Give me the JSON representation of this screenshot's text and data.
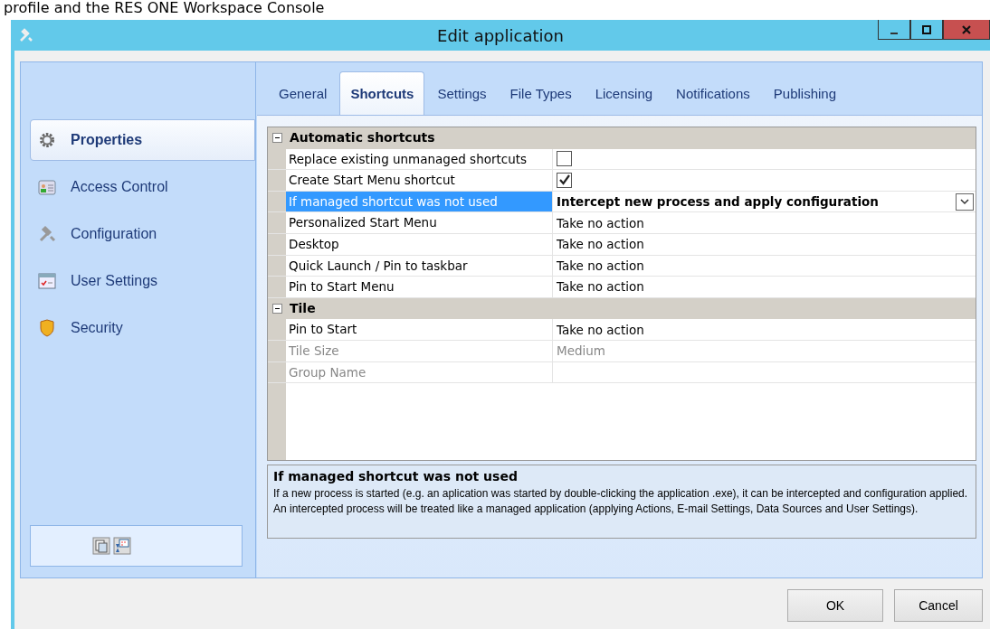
{
  "caption_fragment": "profile and the RES ONE Workspace Console",
  "window": {
    "title": "Edit application"
  },
  "sidebar": {
    "items": [
      {
        "label": "Properties",
        "selected": true
      },
      {
        "label": "Access Control",
        "selected": false
      },
      {
        "label": "Configuration",
        "selected": false
      },
      {
        "label": "User Settings",
        "selected": false
      },
      {
        "label": "Security",
        "selected": false
      }
    ]
  },
  "tabs": [
    {
      "label": "General",
      "selected": false
    },
    {
      "label": "Shortcuts",
      "selected": true
    },
    {
      "label": "Settings",
      "selected": false
    },
    {
      "label": "File Types",
      "selected": false
    },
    {
      "label": "Licensing",
      "selected": false
    },
    {
      "label": "Notifications",
      "selected": false
    },
    {
      "label": "Publishing",
      "selected": false
    }
  ],
  "grid": {
    "groups": [
      {
        "title": "Automatic shortcuts",
        "expanded": true,
        "rows": [
          {
            "label": "Replace existing unmanaged shortcuts",
            "kind": "check",
            "checked": false,
            "selected": false,
            "disabled": false
          },
          {
            "label": "Create Start Menu shortcut",
            "kind": "check",
            "checked": true,
            "selected": false,
            "disabled": false
          },
          {
            "label": "If managed shortcut was not used",
            "kind": "dropdown",
            "value": "Intercept new process and apply configuration",
            "selected": true,
            "disabled": false
          },
          {
            "label": "Personalized Start Menu",
            "kind": "text",
            "value": "Take no action",
            "selected": false,
            "disabled": false
          },
          {
            "label": "Desktop",
            "kind": "text",
            "value": "Take no action",
            "selected": false,
            "disabled": false
          },
          {
            "label": "Quick Launch / Pin to taskbar",
            "kind": "text",
            "value": "Take no action",
            "selected": false,
            "disabled": false
          },
          {
            "label": "Pin to Start Menu",
            "kind": "text",
            "value": "Take no action",
            "selected": false,
            "disabled": false
          }
        ]
      },
      {
        "title": "Tile",
        "expanded": true,
        "rows": [
          {
            "label": "Pin to Start",
            "kind": "text",
            "value": "Take no action",
            "selected": false,
            "disabled": false
          },
          {
            "label": "Tile Size",
            "kind": "text",
            "value": "Medium",
            "selected": false,
            "disabled": true
          },
          {
            "label": "Group Name",
            "kind": "text",
            "selected": false,
            "disabled": true
          }
        ]
      }
    ]
  },
  "description": {
    "title": "If managed shortcut was not used",
    "text": "If a new process is started (e.g. an aplication was started by double-clicking the application .exe), it can be intercepted and configuration applied. An intercepted process will be treated like a managed application (applying Actions, E-mail Settings, Data Sources and User Settings)."
  },
  "buttons": [
    {
      "label": "OK"
    },
    {
      "label": "Cancel"
    }
  ]
}
